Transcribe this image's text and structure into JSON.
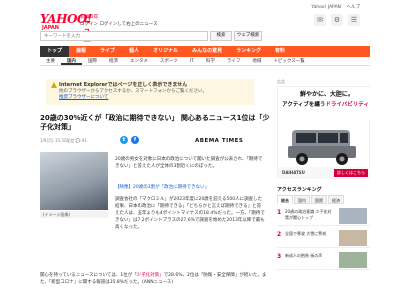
{
  "header": {
    "logo_main": "YAHOO!",
    "logo_sub": "JAPAN",
    "logo_news": "ニュース",
    "links_line1": "ログイン",
    "links_line2_reg": "新規取得",
    "links_line2": "ログインして右上のニュース",
    "right_links": [
      "Yahoo! JAPAN",
      "ヘルプ"
    ],
    "icons": [
      "bell-icon",
      "gear-icon",
      "menu-icon"
    ]
  },
  "search": {
    "placeholder": "キーワードを入力",
    "button": "検索",
    "button2": "ウェブ検索"
  },
  "nav": {
    "items": [
      "トップ",
      "速報",
      "ライブ",
      "個人",
      "オリジナル",
      "みんなの意見",
      "ランキング",
      "有料"
    ],
    "active": 0
  },
  "subnav": {
    "items": [
      "主要",
      "国内",
      "国際",
      "経済",
      "エンタメ",
      "スポーツ",
      "IT",
      "科学",
      "ライフ",
      "地域",
      "トピックス一覧"
    ],
    "active": 1
  },
  "ie_notice": {
    "title": "Internet Explorerではページを正しく表示できません",
    "line1": "他のブラウザーからアクセスするか、スマートフォンからご覧ください。",
    "link": "推奨ブラウザーについて"
  },
  "article": {
    "title": "20歳の30%近くが「政治に期待できない」 関心あるニュース1位は「少子化対策」",
    "meta": "1/9(月) 15:32配信",
    "comment_count": "91",
    "source": "ABEMA TIMES",
    "photo_caption": "(イメージ画像)",
    "p1": "20歳の男女を対象に日本の政治について聞いた調査が公表され、「期待できない」と答えた人が全体の3割近くにのぼった。",
    "quote_link": "【映像】20歳の3割が「政治に期待できない」",
    "p2": "調査会社の「マクロミル」が2023年度に20歳を迎える500人に調査した結果、日本の政治に「期待できる」「どちらかと言えば期待できる」と答えた人は、五年よりも4ポイントマイナスの18.4%だった。一方、「期待できない」は7.2ポイントプラスの27.6%で調査を始めた2013年以降で最も高くなった。",
    "p3_pre": "関心を持っているニュースについては、1位が",
    "p3_hl": "「少子化対策」",
    "p3_post": "で28.6%、2位は「防衛・安全保障」が続いた。また、「新型コロナ」に関する報道は35.8%だった。(ANNニュース)"
  },
  "ad": {
    "label": "広告",
    "line1": "鮮やかに、大胆に。",
    "line2_pre": "アクティブを纏う",
    "line2_em": "ドライバビリティ",
    "brand": "DAIHATSU",
    "cta": "詳しくはこちら"
  },
  "ranking": {
    "title": "アクセスランキング",
    "tabs": [
      "総合",
      "国内",
      "国際",
      "経済"
    ],
    "active_tab": 0,
    "items": [
      {
        "num": "1",
        "text": "20歳の政治意識 少子化対策が関心トップ"
      },
      {
        "num": "2",
        "text": "全国で寒波 大雪に警戒"
      },
      {
        "num": "3",
        "text": "新成人の抱負 街の声"
      }
    ]
  },
  "colors": {
    "brand": "#ff0033",
    "nav": "#ff5722",
    "accent": "#d4003c",
    "notice_bg": "#fdf6e0",
    "twitter": "#1d9bf0",
    "facebook": "#1877f2"
  }
}
